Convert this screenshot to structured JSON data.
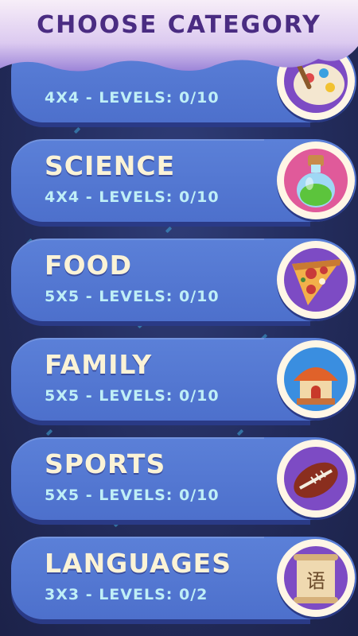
{
  "screen_title": "CHOOSE CATEGORY",
  "categories": [
    {
      "name": "",
      "info": "4X4 - LEVELS: 0/10",
      "icon": "paint-palette-icon"
    },
    {
      "name": "SCIENCE",
      "info": "4X4 - LEVELS: 0/10",
      "icon": "potion-bottle-icon"
    },
    {
      "name": "FOOD",
      "info": "5X5 - LEVELS: 0/10",
      "icon": "pizza-slice-icon"
    },
    {
      "name": "FAMILY",
      "info": "5X5 - LEVELS: 0/10",
      "icon": "house-icon"
    },
    {
      "name": "SPORTS",
      "info": "5X5 - LEVELS: 0/10",
      "icon": "football-icon"
    },
    {
      "name": "LANGUAGES",
      "info": "3X3 - LEVELS: 0/2",
      "icon": "scroll-icon",
      "icon_glyph": "语"
    }
  ],
  "colors": {
    "background": "#232c5c",
    "card": "#5077d4",
    "title": "#4a2c82",
    "name_text": "#fbf3d6",
    "info_text": "#bfeff7",
    "badge_bg": "#7d4bc4"
  }
}
